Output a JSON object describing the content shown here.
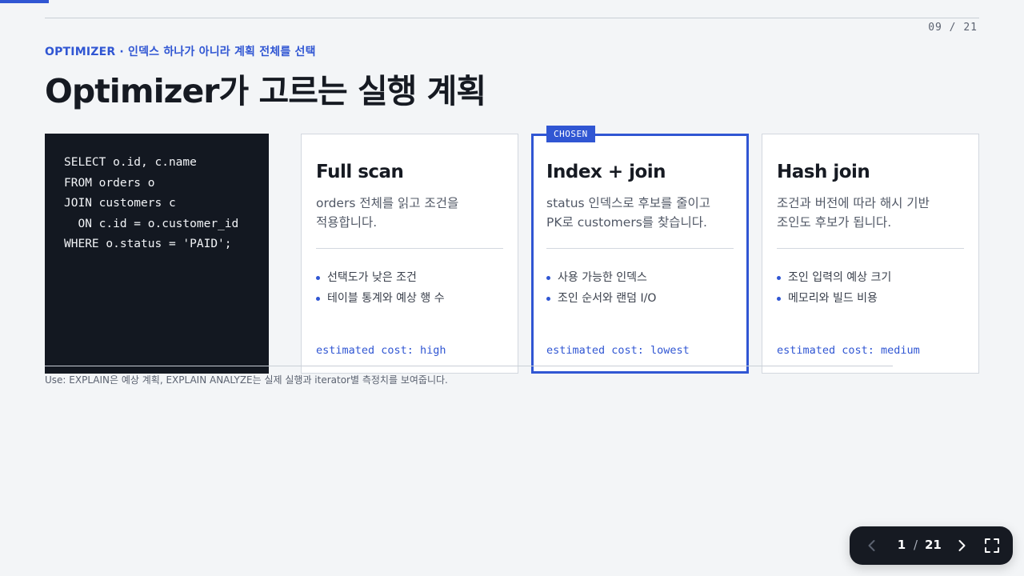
{
  "deck": {
    "page_indicator": "09 / 21",
    "progress_fraction": 0.048
  },
  "slide": {
    "kicker": "OPTIMIZER · 인덱스 하나가 아니라 계획 전체를 선택",
    "title": "Optimizer가 고르는 실행 계획"
  },
  "code": {
    "lines": [
      "SELECT o.id, c.name",
      "FROM orders o",
      "JOIN customers c",
      "  ON c.id = o.customer_id",
      "WHERE o.status = 'PAID';"
    ]
  },
  "cards": [
    {
      "title": "Full scan",
      "desc_lines": [
        "orders 전체를 읽고 조건을",
        "적용합니다."
      ],
      "items": [
        "선택도가 낮은 조건",
        "테이블 통계와 예상 행 수"
      ],
      "cost": "estimated cost: high"
    },
    {
      "tag": "CHOSEN",
      "title": "Index + join",
      "desc_lines": [
        "status 인덱스로 후보를 줄이고",
        "PK로 customers를 찾습니다."
      ],
      "items": [
        "사용 가능한 인덱스",
        "조인 순서와 랜덤 I/O"
      ],
      "cost": "estimated cost: lowest"
    },
    {
      "title": "Hash join",
      "desc_lines": [
        "조건과 버전에 따라 해시 기반",
        "조인도 후보가 됩니다."
      ],
      "items": [
        "조인 입력의 예상 크기",
        "메모리와 빌드 비용"
      ],
      "cost": "estimated cost: medium"
    }
  ],
  "footnote": "Use: EXPLAIN은 예상 계획, EXPLAIN ANALYZE는 실제 실행과 iterator별 측정치를 보여줍니다.",
  "nav": {
    "current": "1",
    "separator": "/",
    "total": "21",
    "icons": {
      "prev": "chevron-left-icon",
      "next": "chevron-right-icon",
      "fullscreen": "fullscreen-icon"
    }
  },
  "colors": {
    "accent": "#3056d3",
    "background": "#f3f5f7",
    "code_bg": "#131821",
    "nav_bg": "#161a22"
  }
}
